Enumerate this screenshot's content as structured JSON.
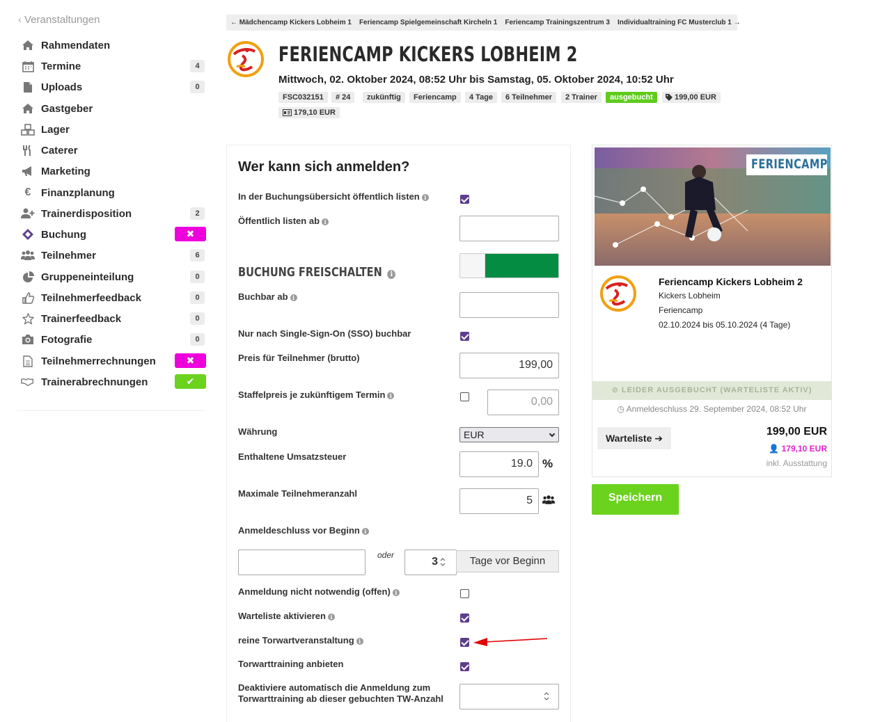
{
  "sidebar": {
    "back_label": "Veranstaltungen",
    "items": [
      {
        "label": "Rahmendaten",
        "icon": "home-icon",
        "badge": ""
      },
      {
        "label": "Termine",
        "icon": "calendar-icon",
        "badge": "4"
      },
      {
        "label": "Uploads",
        "icon": "file-icon",
        "badge": "0"
      },
      {
        "label": "Gastgeber",
        "icon": "home-icon",
        "badge": ""
      },
      {
        "label": "Lager",
        "icon": "cubes-icon",
        "badge": ""
      },
      {
        "label": "Caterer",
        "icon": "cutlery-icon",
        "badge": ""
      },
      {
        "label": "Marketing",
        "icon": "bullhorn-icon",
        "badge": ""
      },
      {
        "label": "Finanzplanung",
        "icon": "euro-icon",
        "badge": ""
      },
      {
        "label": "Trainerdisposition",
        "icon": "user-plus-icon",
        "badge": "2"
      },
      {
        "label": "Buchung",
        "icon": "ticket-icon",
        "badge_status": "x"
      },
      {
        "label": "Teilnehmer",
        "icon": "users-icon",
        "badge": "6"
      },
      {
        "label": "Gruppeneinteilung",
        "icon": "pie-chart-icon",
        "badge": "0"
      },
      {
        "label": "Teilnehmerfeedback",
        "icon": "thumbs-up-icon",
        "badge": "0"
      },
      {
        "label": "Trainerfeedback",
        "icon": "star-icon",
        "badge": "0"
      },
      {
        "label": "Fotografie",
        "icon": "camera-icon",
        "badge": "0"
      },
      {
        "label": "Teilnehmerrechnungen",
        "icon": "file-text-icon",
        "badge_status": "x"
      },
      {
        "label": "Trainerabrechnungen",
        "icon": "handshake-icon",
        "badge_status": "ok"
      }
    ]
  },
  "event_nav": [
    "← Mädchencamp Kickers Lobheim 1",
    "Feriencamp Spielgemeinschaft Kircheln 1",
    "Feriencamp Trainingszentrum 3",
    "Individualtraining FC Musterclub 1 →"
  ],
  "header": {
    "title": "FERIENCAMP KICKERS LOBHEIM 2",
    "subtitle": "Mittwoch, 02. Oktober 2024, 08:52 Uhr bis Samstag, 05. Oktober 2024, 10:52 Uhr",
    "tags": [
      "FSC032151",
      "# 24",
      "zukünftig",
      "Feriencamp",
      "4 Tage",
      "6 Teilnehmer",
      "2 Trainer",
      "ausgebucht",
      "199,00 EUR",
      "179,10 EUR"
    ]
  },
  "form": {
    "heading": "Wer kann sich anmelden?",
    "public_list_label": "In der Buchungsübersicht öffentlich listen",
    "public_from_label": "Öffentlich listen ab",
    "section_title": "BUCHUNG FREISCHALTEN",
    "bookable_from_label": "Buchbar ab",
    "sso_label": "Nur nach Single-Sign-On (SSO) buchbar",
    "price_label": "Preis für Teilnehmer (brutto)",
    "price_value": "199,00",
    "staffel_label": "Staffelpreis je zukünftigem Termin",
    "staffel_placeholder": "0,00",
    "currency_label": "Währung",
    "currency_value": "EUR",
    "vat_label": "Enthaltene Umsatzsteuer",
    "vat_value": "19.0",
    "vat_unit": "%",
    "max_label": "Maximale Teilnehmeranzahl",
    "max_value": "5",
    "deadline_label": "Anmeldeschluss vor Beginn",
    "or_label": "oder",
    "days_value": "3",
    "days_button": "Tage vor Beginn",
    "open_label": "Anmeldung nicht notwendig (offen)",
    "waitlist_label": "Warteliste aktivieren",
    "goalkeeper_label": "reine Torwartveranstaltung",
    "gk_training_label": "Torwarttraining anbieten",
    "deactivate_label_1": "Deaktiviere automatisch die Anmeldung zum",
    "deactivate_label_2": "Torwarttraining ab dieser gebuchten TW-Anzahl"
  },
  "card": {
    "banner_text": "FERIENCAMP",
    "title": "Feriencamp Kickers Lobheim 2",
    "club": "Kickers Lobheim",
    "type": "Feriencamp",
    "dates": "02.10.2024 bis 05.10.2024 (4 Tage)",
    "status": "⊘ LEIDER AUSGEBUCHT (WARTELISTE AKTIV)",
    "deadline": "◷ Anmeldeschluss 29. September 2024, 08:52 Uhr",
    "waitlist_button": "Warteliste ➔",
    "price": "199,00 EUR",
    "price_member": "179,10 EUR",
    "price_note": "inkl. Ausstattung"
  },
  "save_label": "Speichern",
  "colors": {
    "accent_green": "#6bd21d",
    "magenta": "#ee00dd",
    "toggle_green": "#058c43",
    "checkbox": "#5c3e8c"
  }
}
